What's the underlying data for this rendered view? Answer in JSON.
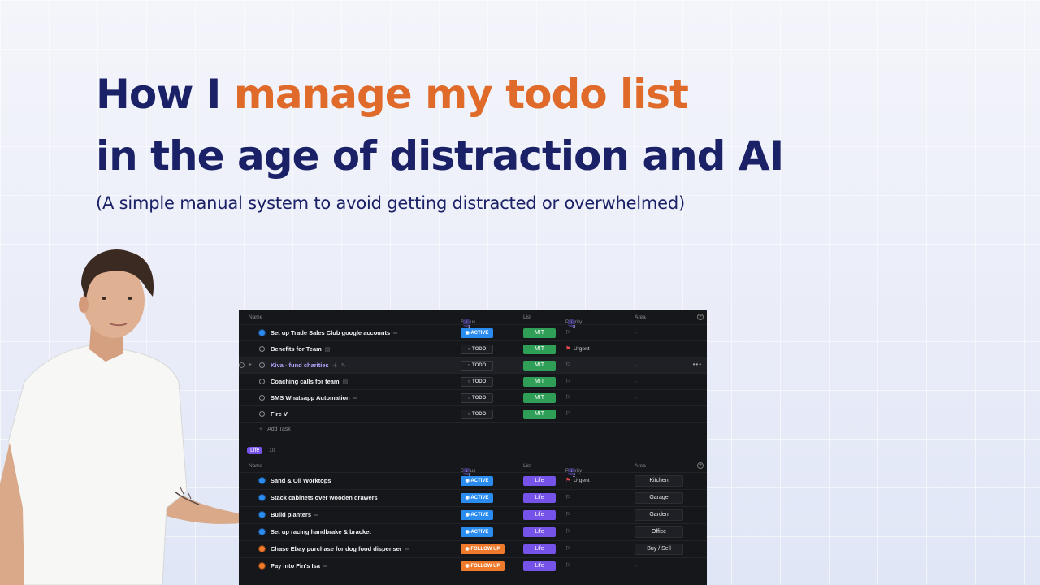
{
  "title": {
    "line1_prefix": "How I ",
    "line1_accent": "manage my todo list",
    "line2": "in the age of distraction and AI",
    "subtitle": "(A simple manual system to avoid getting distracted or overwhelmed)"
  },
  "table": {
    "headers": {
      "name": "Name",
      "status": "Status",
      "status_count": "1",
      "list": "List",
      "priority": "Priority",
      "priority_count": "2",
      "area": "Area"
    },
    "mit_rows": [
      {
        "name": "Set up Trade Sales Club google accounts",
        "status": "ACTIVE",
        "list": "MIT",
        "priority": "",
        "area": "-"
      },
      {
        "name": "Benefits for Team",
        "status": "TODO",
        "list": "MIT",
        "priority": "Urgent",
        "area": "-"
      },
      {
        "name": "Kiva - fund charities",
        "status": "TODO",
        "list": "MIT",
        "priority": "",
        "area": "-"
      },
      {
        "name": "Coaching calls for team",
        "status": "TODO",
        "list": "MIT",
        "priority": "",
        "area": "-"
      },
      {
        "name": "SMS Whatsapp Automation",
        "status": "TODO",
        "list": "MIT",
        "priority": "",
        "area": "-"
      },
      {
        "name": "Fire V",
        "status": "TODO",
        "list": "MIT",
        "priority": "",
        "area": "-"
      }
    ],
    "add_task": "Add Task",
    "group": {
      "label": "Life",
      "count": "10"
    },
    "life_headers": {
      "name": "Name",
      "status": "Status",
      "status_count": "1",
      "list": "List",
      "priority": "Priority",
      "priority_count": "2",
      "area": "Area"
    },
    "life_rows": [
      {
        "name": "Sand & Oil Worktops",
        "status": "ACTIVE",
        "list": "Life",
        "priority": "Urgent",
        "area": "Kitchen"
      },
      {
        "name": "Stack cabinets over wooden drawers",
        "status": "ACTIVE",
        "list": "Life",
        "priority": "",
        "area": "Garage"
      },
      {
        "name": "Build planters",
        "status": "ACTIVE",
        "list": "Life",
        "priority": "",
        "area": "Garden"
      },
      {
        "name": "Set up racing handbrake & bracket",
        "status": "ACTIVE",
        "list": "Life",
        "priority": "",
        "area": "Office"
      },
      {
        "name": "Chase Ebay purchase for dog food dispenser",
        "status": "FOLLOW UP",
        "list": "Life",
        "priority": "",
        "area": "Buy / Sell"
      },
      {
        "name": "Pay into Fin's Isa",
        "status": "FOLLOW UP",
        "list": "Life",
        "priority": "",
        "area": "-"
      }
    ]
  },
  "colors": {
    "title_navy": "#1b2166",
    "title_accent": "#e06a2a",
    "active": "#2b8cf0",
    "follow_up": "#f07a2b",
    "mit": "#2f9e57",
    "life": "#7552e8",
    "urgent_flag": "#e5484d"
  }
}
